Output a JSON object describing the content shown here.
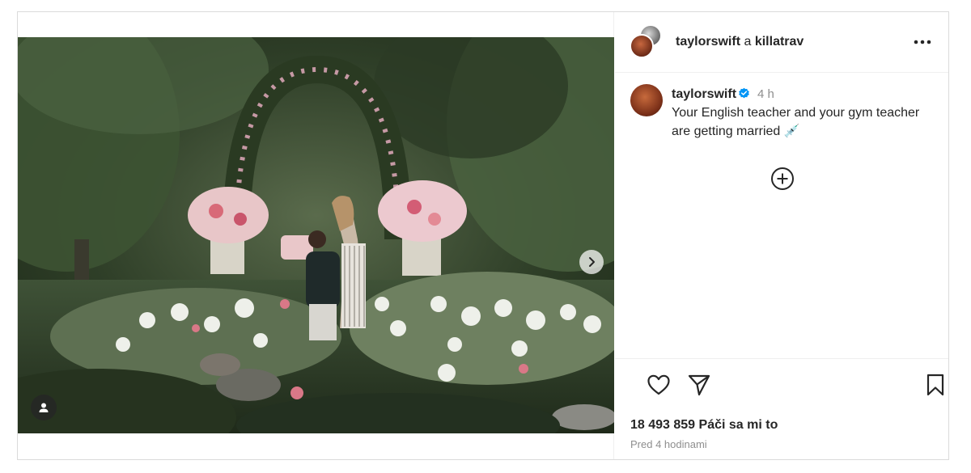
{
  "post": {
    "photo": {
      "alt_icon": "engagement-garden-photo"
    },
    "carousel": {
      "next_icon": "chevron-right-icon"
    },
    "tags": {
      "icon": "user-tag-icon"
    }
  },
  "header": {
    "user1": "taylorswift",
    "conjunction": "a",
    "user2": "killatrav",
    "more_icon": "more-horizontal-icon"
  },
  "caption": {
    "username": "taylorswift",
    "verified_icon": "verified-badge-icon",
    "time": "4 h",
    "text": "Your English teacher and your gym teacher are getting married 💉"
  },
  "add_icon": "add-circle-icon",
  "actions": {
    "like_icon": "heart-icon",
    "share_icon": "send-icon",
    "save_icon": "bookmark-icon",
    "likes": "18 493 859 Páči sa mi to",
    "timestamp": "Pred 4 hodinami"
  },
  "colors": {
    "text": "#262626",
    "secondary": "#8e8e8e",
    "verified": "#0095f6",
    "border": "#dbdbdb"
  }
}
